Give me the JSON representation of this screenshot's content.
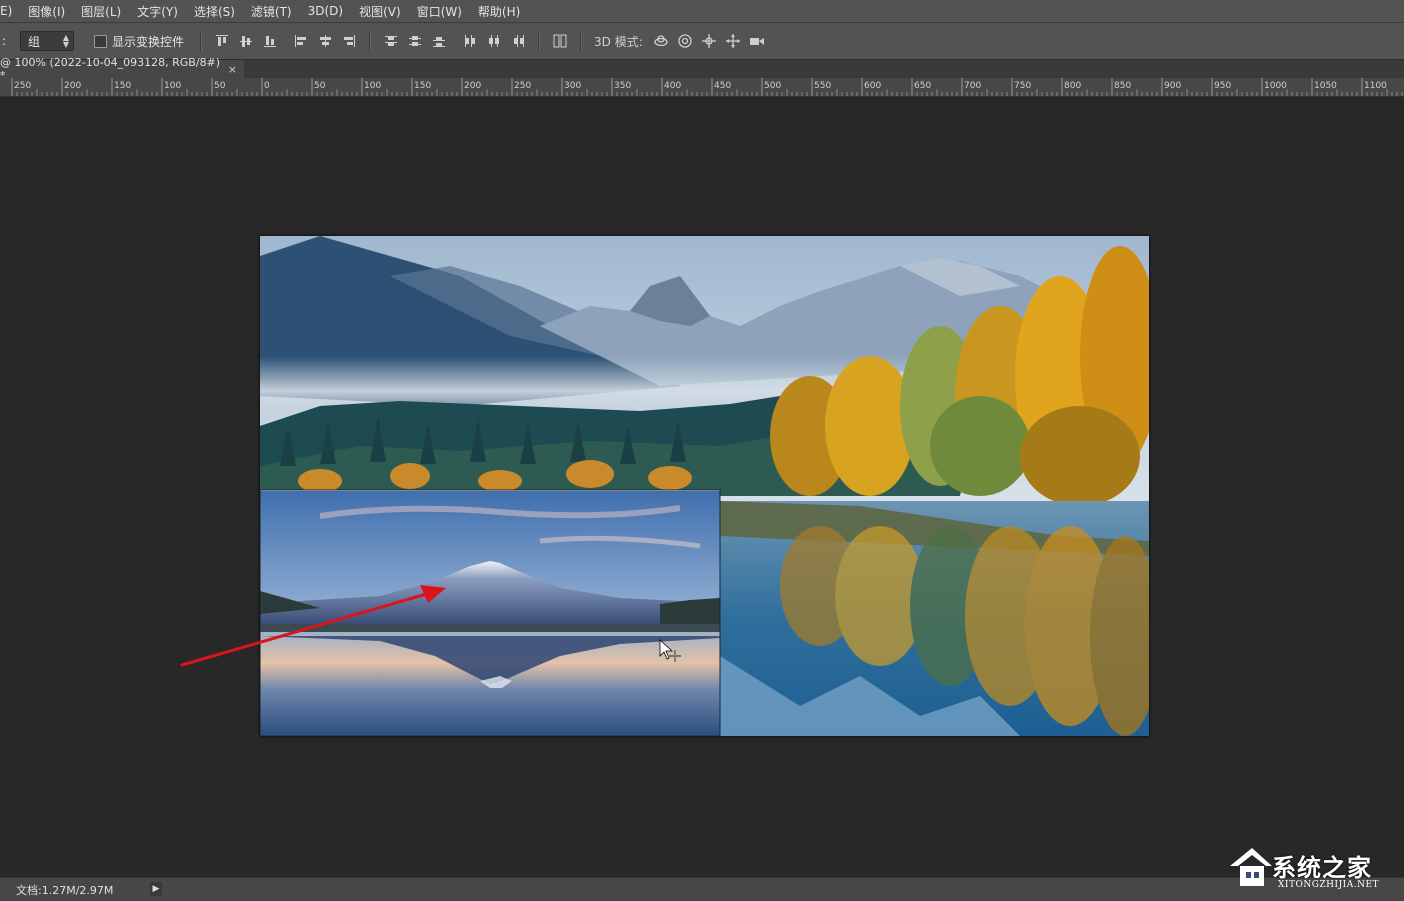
{
  "menubar": {
    "items": [
      "E)",
      "图像(I)",
      "图层(L)",
      "文字(Y)",
      "选择(S)",
      "滤镜(T)",
      "3D(D)",
      "视图(V)",
      "窗口(W)",
      "帮助(H)"
    ]
  },
  "options": {
    "leading": ":",
    "auto_select_value": "组",
    "show_transform_label": "显示变换控件",
    "mode3d_label": "3D 模式:",
    "icons": [
      "align-top-icon",
      "align-vcenter-icon",
      "align-bottom-icon",
      "align-left-icon",
      "align-hcenter-icon",
      "align-right-icon",
      "distribute-top-icon",
      "distribute-vcenter-icon",
      "distribute-bottom-icon",
      "distribute-left-icon",
      "distribute-hcenter-icon",
      "distribute-right-icon",
      "auto-align-icon",
      "rotate-3d-icon",
      "roll-3d-icon",
      "drag-3d-icon",
      "slide-3d-icon",
      "scale-3d-icon"
    ]
  },
  "tab": {
    "title": "@ 100% (2022-10-04_093128, RGB/8#) *",
    "close": "×"
  },
  "ruler": {
    "labels": [
      "250",
      "200",
      "150",
      "100",
      "50",
      "0",
      "50",
      "100",
      "150",
      "200",
      "250",
      "300",
      "350",
      "400",
      "450",
      "500",
      "550",
      "600",
      "650",
      "700",
      "750",
      "800",
      "850",
      "900",
      "950",
      "1000",
      "1050",
      "1100"
    ]
  },
  "status": {
    "doc_size": "文档:1.27M/2.97M",
    "play": "▶"
  },
  "watermark": {
    "title": "系统之家",
    "sub": "XITONGZHIJIA.NET"
  },
  "colors": {
    "annotation_arrow": "#d9141a",
    "panel": "#535353",
    "canvas_bg": "#282828"
  }
}
